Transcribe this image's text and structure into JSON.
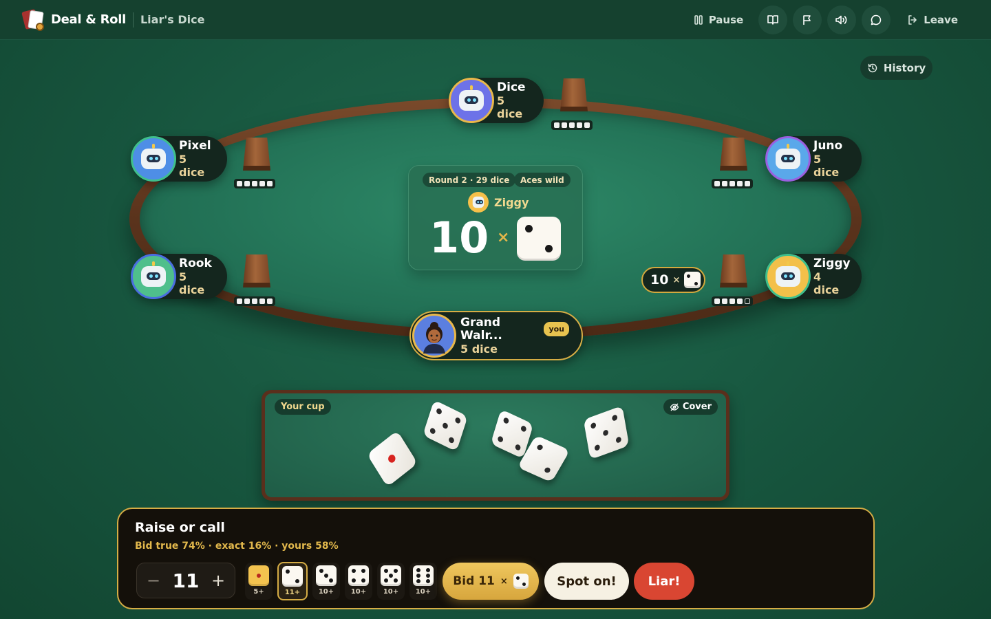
{
  "topbar": {
    "brand": "Deal & Roll",
    "game_name": "Liar's Dice",
    "pause_label": "Pause",
    "leave_label": "Leave",
    "icons": [
      "rules-book-icon",
      "flag-icon",
      "sound-icon",
      "chat-icon"
    ]
  },
  "history_label": "History",
  "players": {
    "dice": {
      "name": "Dice",
      "dice": "5 dice",
      "cup_count": 5,
      "remaining": 5
    },
    "pixel": {
      "name": "Pixel",
      "dice": "5 dice",
      "cup_count": 5,
      "remaining": 5
    },
    "juno": {
      "name": "Juno",
      "dice": "5 dice",
      "cup_count": 5,
      "remaining": 5
    },
    "rook": {
      "name": "Rook",
      "dice": "5 dice",
      "cup_count": 5,
      "remaining": 5
    },
    "ziggy": {
      "name": "Ziggy",
      "dice": "4 dice",
      "cup_count": 5,
      "remaining": 4
    },
    "you": {
      "name": "Grand Walr...",
      "badge": "you",
      "dice": "5 dice"
    }
  },
  "current_bid": {
    "round_info": "Round 2 · 29 dice",
    "rule": "Aces wild",
    "bidder": "Ziggy",
    "quantity": "10",
    "times": "×",
    "face": 2
  },
  "last_bid_tag": {
    "quantity": "10",
    "times": "×",
    "face": 2
  },
  "your_cup": {
    "label": "Your cup",
    "cover_label": "Cover",
    "dice": [
      1,
      4,
      4,
      2,
      5
    ]
  },
  "action": {
    "title": "Raise or call",
    "odds": "Bid true 74% · exact 16% · yours 58%",
    "quantity": "11",
    "faces": [
      {
        "face": 1,
        "min": "5+"
      },
      {
        "face": 2,
        "min": "11+",
        "selected": true
      },
      {
        "face": 3,
        "min": "10+"
      },
      {
        "face": 4,
        "min": "10+"
      },
      {
        "face": 5,
        "min": "10+"
      },
      {
        "face": 6,
        "min": "10+"
      }
    ],
    "bid_label": "Bid 11",
    "bid_times": "×",
    "spot_on_label": "Spot on!",
    "liar_label": "Liar!"
  },
  "colors": {
    "felt": "#237357",
    "rail": "#5a331c",
    "accent_gold": "#d6ad45",
    "liar_red": "#d94632"
  }
}
